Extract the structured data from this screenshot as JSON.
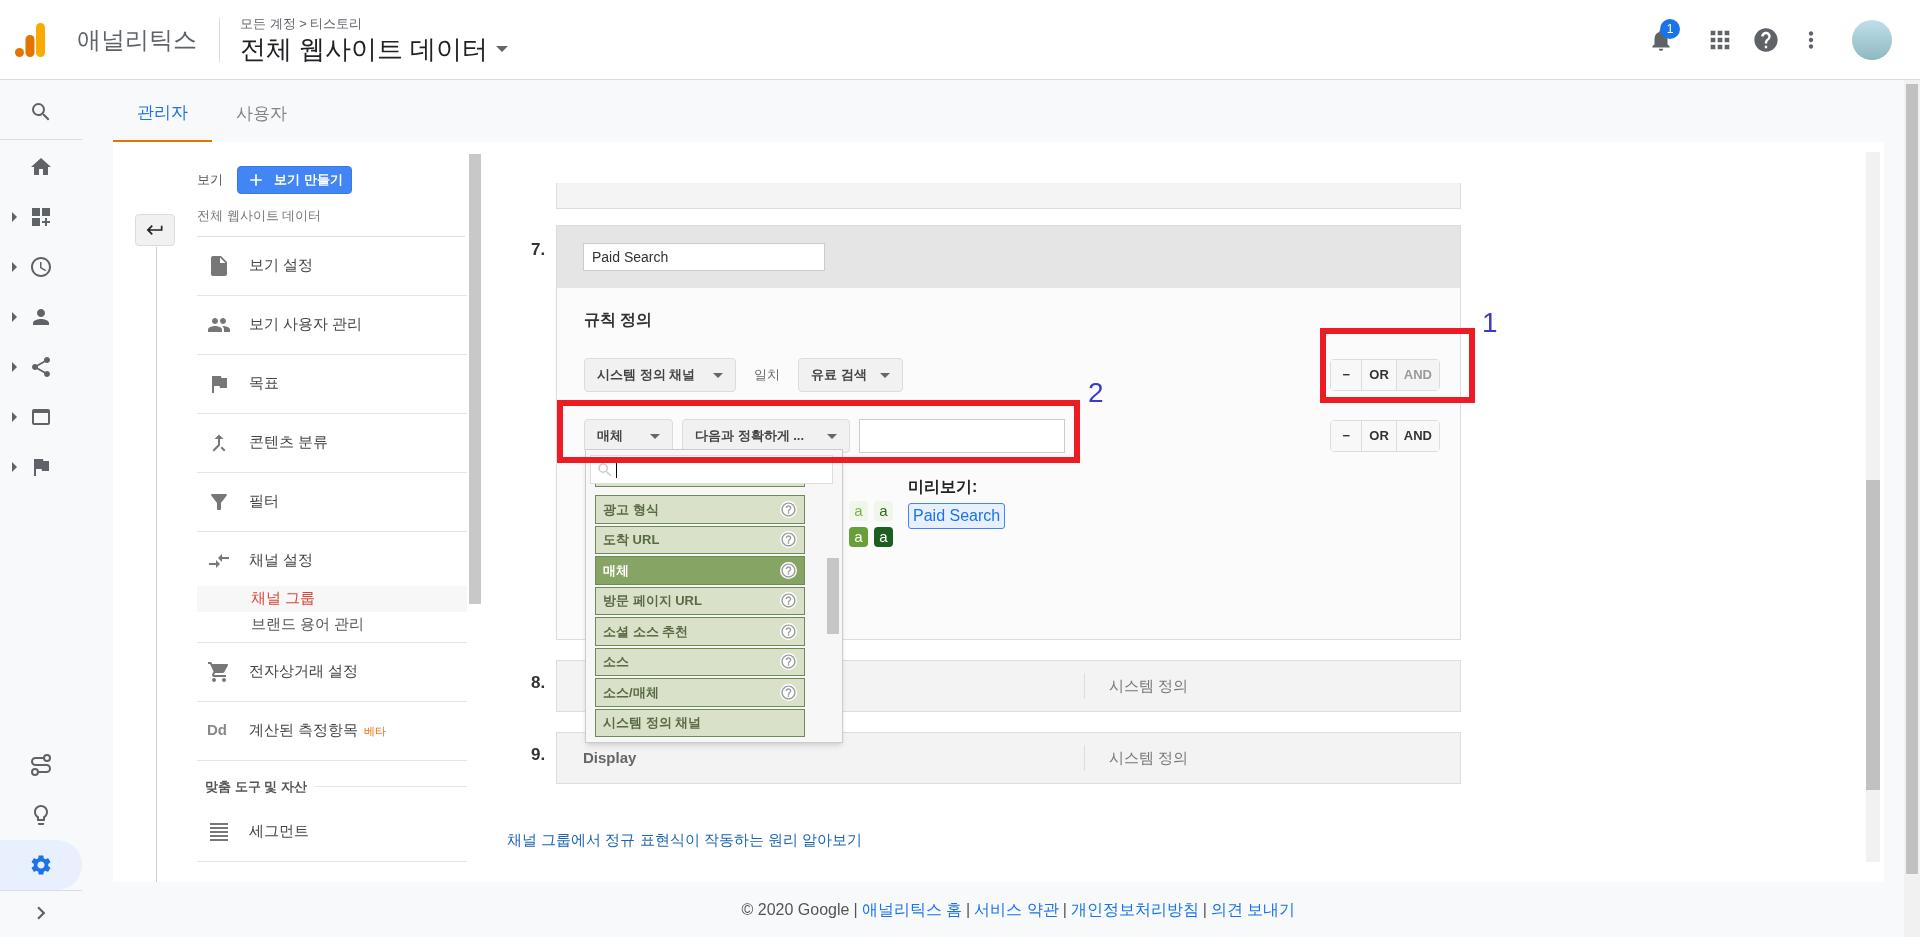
{
  "header": {
    "app_name": "애널리틱스",
    "breadcrumb": "모든 계정 > 티스토리",
    "property": "전체 웹사이트 데이터",
    "notification_count": "1"
  },
  "rail": [
    {
      "kind": "search",
      "selected": false,
      "expandable": false
    },
    {
      "kind": "home",
      "selected": false,
      "expandable": false
    },
    {
      "kind": "customization",
      "selected": false,
      "expandable": true
    },
    {
      "kind": "realtime",
      "selected": false,
      "expandable": true
    },
    {
      "kind": "audience",
      "selected": false,
      "expandable": true
    },
    {
      "kind": "acquisition",
      "selected": false,
      "expandable": true
    },
    {
      "kind": "behavior",
      "selected": false,
      "expandable": true
    },
    {
      "kind": "conversions",
      "selected": false,
      "expandable": true
    },
    {
      "kind": "discover",
      "selected": false,
      "expandable": false
    },
    {
      "kind": "insights",
      "selected": false,
      "expandable": false
    },
    {
      "kind": "admin",
      "selected": true,
      "expandable": false
    }
  ],
  "tabs": [
    {
      "label": "관리자",
      "selected": true
    },
    {
      "label": "사용자",
      "selected": false
    }
  ],
  "view_panel": {
    "label": "보기",
    "create_button": "보기 만들기",
    "view_name": "전체 웹사이트 데이터",
    "items": [
      {
        "kind": "settings",
        "label": "보기 설정"
      },
      {
        "kind": "users",
        "label": "보기 사용자 관리"
      },
      {
        "kind": "goals",
        "label": "목표"
      },
      {
        "kind": "grouping",
        "label": "콘텐츠 분류"
      },
      {
        "kind": "filters",
        "label": "필터"
      },
      {
        "kind": "channels",
        "label": "채널 설정",
        "children": [
          {
            "label": "채널 그룹",
            "selected": true
          },
          {
            "label": "브랜드 용어 관리",
            "selected": false
          }
        ]
      },
      {
        "kind": "ecommerce",
        "label": "전자상거래 설정"
      },
      {
        "kind": "text_icon",
        "icon_text": "Dd",
        "label": "계산된 측정항목",
        "badge": "베타"
      },
      {
        "kind": "section",
        "label": "맞춤 도구 및 자산"
      },
      {
        "kind": "segments",
        "label": "세그먼트"
      }
    ]
  },
  "editor": {
    "number": "7.",
    "name": "Paid Search",
    "heading": "규칙 정의",
    "rules": [
      {
        "dimension": "시스템 정의 채널",
        "match_label": "일치",
        "value": "유료 검색",
        "buttons": [
          {
            "label": "−",
            "disabled": false
          },
          {
            "label": "OR",
            "disabled": false
          },
          {
            "label": "AND",
            "disabled": true
          }
        ]
      },
      {
        "dimension": "매체",
        "operator": "다음과 정확하게 ...",
        "buttons": [
          {
            "label": "−",
            "disabled": false
          },
          {
            "label": "OR",
            "disabled": false
          },
          {
            "label": "AND",
            "disabled": false
          }
        ]
      }
    ],
    "dropdown": [
      {
        "label": "광고 형식",
        "help": true,
        "selected": false
      },
      {
        "label": "도착 URL",
        "help": true,
        "selected": false
      },
      {
        "label": "매체",
        "help": true,
        "selected": true
      },
      {
        "label": "방문 페이지 URL",
        "help": true,
        "selected": false
      },
      {
        "label": "소셜 소스 추천",
        "help": true,
        "selected": false
      },
      {
        "label": "소스",
        "help": true,
        "selected": false
      },
      {
        "label": "소스/매체",
        "help": true,
        "selected": false
      },
      {
        "label": "시스템 정의 채널",
        "help": false,
        "selected": false
      }
    ],
    "swatches": [
      {
        "label": "a",
        "kind": "pale",
        "color": "#7cb342"
      },
      {
        "label": "a",
        "kind": "pale",
        "color": "#33691e"
      },
      {
        "label": "a",
        "kind": "solid",
        "color": "#689f38"
      },
      {
        "label": "a",
        "kind": "solid",
        "color": "#1b5e20"
      }
    ],
    "preview_label": "미리보기:",
    "preview_tag": "Paid Search"
  },
  "groups": [
    {
      "number": "8.",
      "definition": "시스템 정의"
    },
    {
      "number": "9.",
      "name": "Display",
      "definition": "시스템 정의"
    }
  ],
  "help_link": "채널 그룹에서 정규 표현식이 작동하는 원리 알아보기",
  "footer": {
    "copyright": "© 2020 Google",
    "separator": "|",
    "links": [
      "애널리틱스 홈",
      "서비스 약관",
      "개인정보처리방침",
      "의견 보내기"
    ]
  },
  "annotations": [
    {
      "label": "1"
    },
    {
      "label": "2"
    }
  ]
}
